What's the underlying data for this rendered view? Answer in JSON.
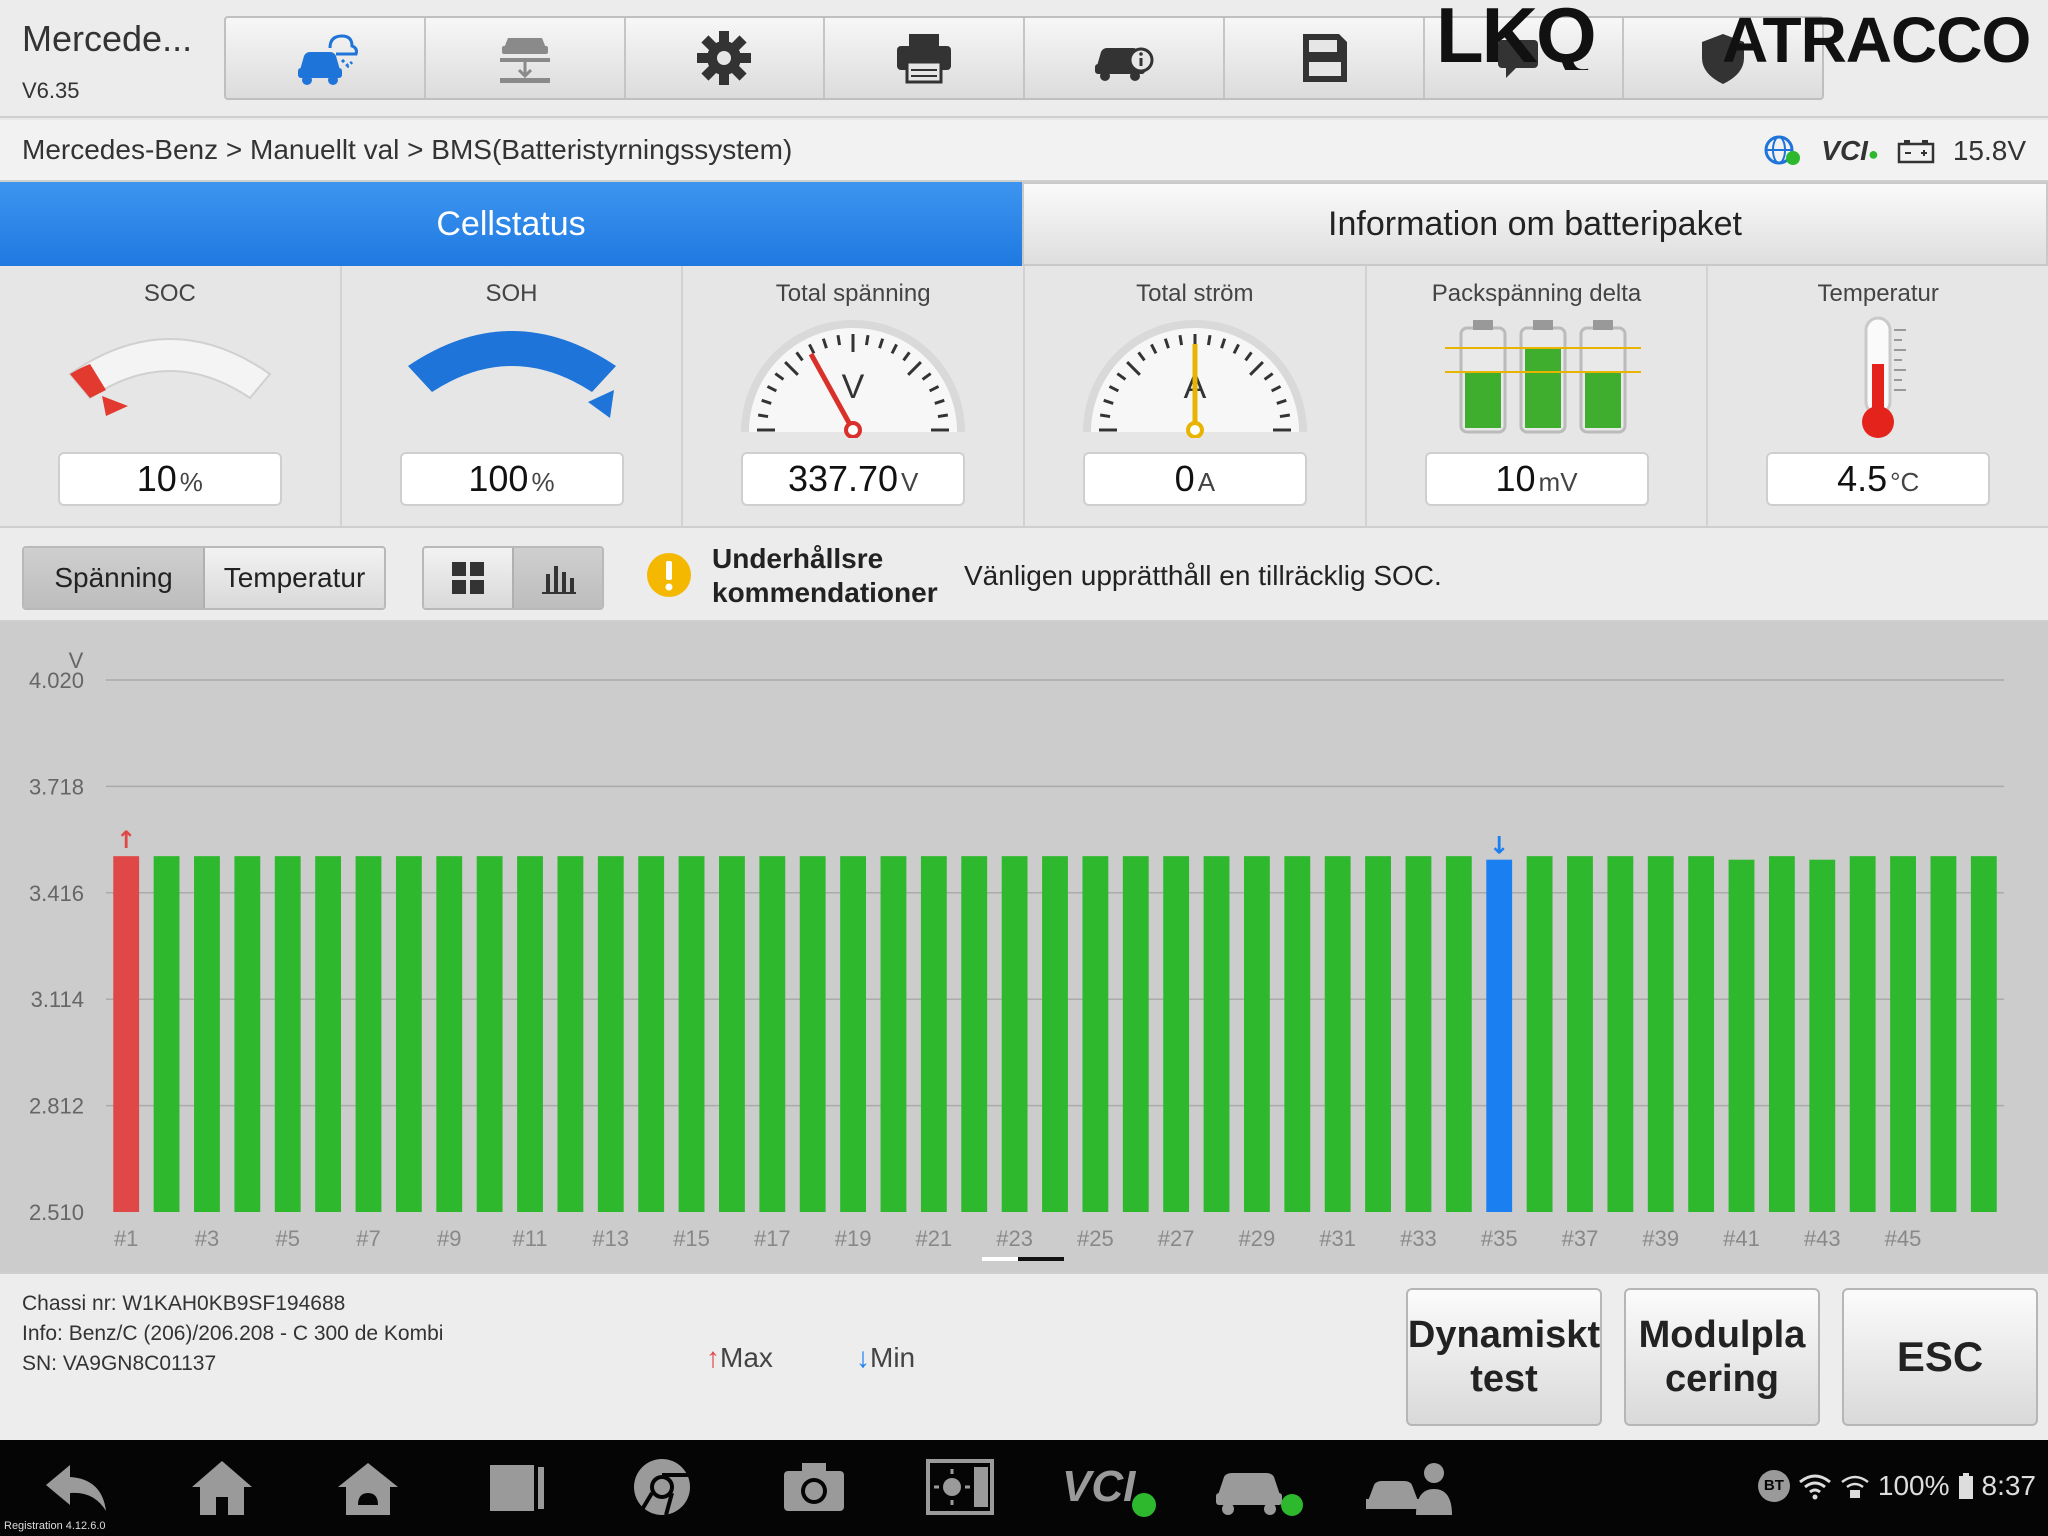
{
  "header": {
    "app_title": "Mercede...",
    "version": "V6.35",
    "toolbar": [
      {
        "name": "remote-expert-icon",
        "color": "#1e74d8"
      },
      {
        "name": "car-lift-icon",
        "color": "#8a8a8a"
      },
      {
        "name": "gear-icon",
        "color": "#333333"
      },
      {
        "name": "printer-icon",
        "color": "#333333"
      },
      {
        "name": "car-info-icon",
        "color": "#333333"
      },
      {
        "name": "save-icon",
        "color": "#333333"
      },
      {
        "name": "chat-icon",
        "color": "#333333"
      },
      {
        "name": "shield-icon",
        "color": "#333333"
      }
    ],
    "brand_logo_text": "LKQ ATRACCO"
  },
  "breadcrumb": {
    "path": "Mercedes-Benz > Manuellt val > BMS(Batteristyrningssystem)",
    "vci_label": "VCI",
    "battery_voltage": "15.8V"
  },
  "tabs": [
    {
      "label": "Cellstatus",
      "active": true
    },
    {
      "label": "Information om batteripaket",
      "active": false
    }
  ],
  "gauges": [
    {
      "label": "SOC",
      "value": "10",
      "unit": "%",
      "level": 0.1
    },
    {
      "label": "SOH",
      "value": "100",
      "unit": "%",
      "level": 1.0
    },
    {
      "label": "Total spänning",
      "value": "337.70",
      "unit": "V",
      "dial_letter": "V"
    },
    {
      "label": "Total ström",
      "value": "0",
      "unit": "A",
      "dial_letter": "A"
    },
    {
      "label": "Packspänning delta",
      "value": "10",
      "unit": "mV"
    },
    {
      "label": "Temperatur",
      "value": "4.5",
      "unit": "°C"
    }
  ],
  "controls": {
    "mode_voltage": "Spänning",
    "mode_temperature": "Temperatur",
    "maint_title": "Underhållsre kommendationer",
    "maint_text": "Vänligen upprätthåll en tillräcklig SOC."
  },
  "chart_data": {
    "type": "bar",
    "ylabel": "V",
    "ylim": [
      2.51,
      4.02
    ],
    "yticks": [
      "4.020",
      "3.718",
      "3.416",
      "3.114",
      "2.812",
      "2.510"
    ],
    "categories": [
      "#1",
      "#2",
      "#3",
      "#4",
      "#5",
      "#6",
      "#7",
      "#8",
      "#9",
      "#10",
      "#11",
      "#12",
      "#13",
      "#14",
      "#15",
      "#16",
      "#17",
      "#18",
      "#19",
      "#20",
      "#21",
      "#22",
      "#23",
      "#24",
      "#25",
      "#26",
      "#27",
      "#28",
      "#29",
      "#30",
      "#31",
      "#32",
      "#33",
      "#34",
      "#35",
      "#36",
      "#37",
      "#38",
      "#39",
      "#40",
      "#41",
      "#42",
      "#43",
      "#44",
      "#45",
      "#46",
      "#47"
    ],
    "xtick_labels": [
      "#1",
      "#3",
      "#5",
      "#7",
      "#9",
      "#11",
      "#13",
      "#15",
      "#17",
      "#19",
      "#21",
      "#23",
      "#25",
      "#27",
      "#29",
      "#31",
      "#33",
      "#35",
      "#37",
      "#39",
      "#41",
      "#43",
      "#45"
    ],
    "values": [
      3.52,
      3.52,
      3.52,
      3.52,
      3.52,
      3.52,
      3.52,
      3.52,
      3.52,
      3.52,
      3.52,
      3.52,
      3.52,
      3.52,
      3.52,
      3.52,
      3.52,
      3.52,
      3.52,
      3.52,
      3.52,
      3.52,
      3.52,
      3.52,
      3.52,
      3.52,
      3.52,
      3.52,
      3.52,
      3.52,
      3.52,
      3.52,
      3.52,
      3.52,
      3.51,
      3.52,
      3.52,
      3.52,
      3.52,
      3.52,
      3.51,
      3.52,
      3.51,
      3.52,
      3.52,
      3.52,
      3.52
    ],
    "max_index": 0,
    "min_index": 34,
    "colors": {
      "normal": "#2eb82e",
      "max": "#e04848",
      "min": "#1a7ff0"
    }
  },
  "footer": {
    "chassis": "Chassi nr: W1KAH0KB9SF194688",
    "info": "Info: Benz/C (206)/206.208 - C 300 de Kombi",
    "sn": "SN: VA9GN8C01137",
    "legend_max": "Max",
    "legend_min": "Min",
    "btn_dynamic": "Dynamiskt test",
    "btn_module": "Modulpla cering",
    "btn_esc": "ESC"
  },
  "system": {
    "registration": "Registration 4.12.6.0",
    "bt": "BT",
    "battery": "100%",
    "time": "8:37",
    "nav_vci": "VCI"
  }
}
